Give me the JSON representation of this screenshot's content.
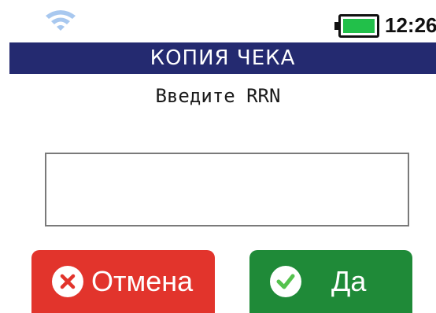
{
  "status_bar": {
    "wifi_icon": "wifi-icon",
    "battery_icon": "battery-icon",
    "battery_level": 1.0,
    "time": "12:26"
  },
  "header": {
    "title": "КОПИЯ ЧЕКА"
  },
  "form": {
    "prompt": "Введите RRN",
    "rrn_value": ""
  },
  "buttons": {
    "cancel_label": "Отмена",
    "cancel_icon": "close-circle-icon",
    "ok_label": "Да",
    "ok_icon": "check-circle-icon"
  },
  "colors": {
    "title_bar": "#242a70",
    "cancel": "#e2342c",
    "ok": "#1f8a38",
    "battery": "#22c04a",
    "wifi": "#a8c8ef"
  }
}
